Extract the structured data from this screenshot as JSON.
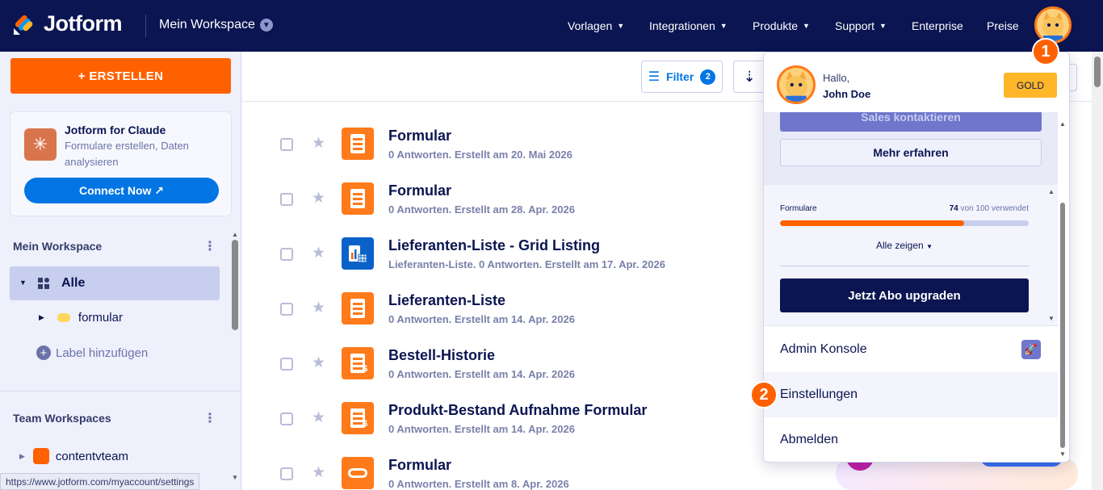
{
  "topbar": {
    "logo_text": "Jotform",
    "workspace": "Mein Workspace",
    "nav": [
      {
        "label": "Vorlagen",
        "caret": true
      },
      {
        "label": "Integrationen",
        "caret": true
      },
      {
        "label": "Produkte",
        "caret": true
      },
      {
        "label": "Support",
        "caret": true
      },
      {
        "label": "Enterprise",
        "caret": false
      },
      {
        "label": "Preise",
        "caret": false
      }
    ]
  },
  "sidebar": {
    "create_label": "+ ERSTELLEN",
    "claude": {
      "title": "Jotform for Claude",
      "subtitle": "Formulare erstellen, Daten analysieren",
      "connect_label": "Connect Now ↗"
    },
    "my_workspace_title": "Mein Workspace",
    "all_label": "Alle",
    "folder_label": "formular",
    "add_label": "Label hinzufügen",
    "team_title": "Team Workspaces",
    "team_item": "contentvteam"
  },
  "status_url": "https://www.jotform.com/myaccount/settings",
  "toolbar": {
    "filter_label": "Filter",
    "filter_count": "2"
  },
  "forms": [
    {
      "title": "Formular",
      "subtitle": "0 Antworten. Erstellt am 20. Mai 2026",
      "icon": "form-icon"
    },
    {
      "title": "Formular",
      "subtitle": "0 Antworten. Erstellt am 28. Apr. 2026",
      "icon": "form-icon"
    },
    {
      "title": "Lieferanten-Liste - Grid Listing",
      "subtitle": "Lieferanten-Liste. 0 Antworten. Erstellt am 17. Apr. 2026",
      "icon": "grid-listing-icon"
    },
    {
      "title": "Lieferanten-Liste",
      "subtitle": "0 Antworten. Erstellt am 14. Apr. 2026",
      "icon": "form-icon"
    },
    {
      "title": "Bestell-Historie",
      "subtitle": "0 Antworten. Erstellt am 14. Apr. 2026",
      "icon": "payment-form-icon"
    },
    {
      "title": "Produkt-Bestand Aufnahme Formular",
      "subtitle": "0 Antworten. Erstellt am 14. Apr. 2026",
      "icon": "payment-form-icon"
    },
    {
      "title": "Formular",
      "subtitle": "0 Antworten. Erstellt am 8. Apr. 2026",
      "icon": "card-form-icon"
    }
  ],
  "dropdown": {
    "hello": "Hallo,",
    "name": "John Doe",
    "plan_badge": "GOLD",
    "sales_label": "Sales kontaktieren",
    "learn_label": "Mehr erfahren",
    "usage_label": "Formulare",
    "usage_used": "74",
    "usage_rest": "von 100 verwendet",
    "usage_fraction": 0.74,
    "show_all_label": "Alle zeigen",
    "upgrade_label": "Jetzt Abo upgraden",
    "admin_label": "Admin Konsole",
    "settings_label": "Einstellungen",
    "logout_label": "Abmelden"
  },
  "steps": [
    "1",
    "2"
  ],
  "colors": {
    "nav_bg": "#0a1551",
    "accent": "#ff6100",
    "blue": "#0075e3",
    "gold": "#ffb629"
  }
}
